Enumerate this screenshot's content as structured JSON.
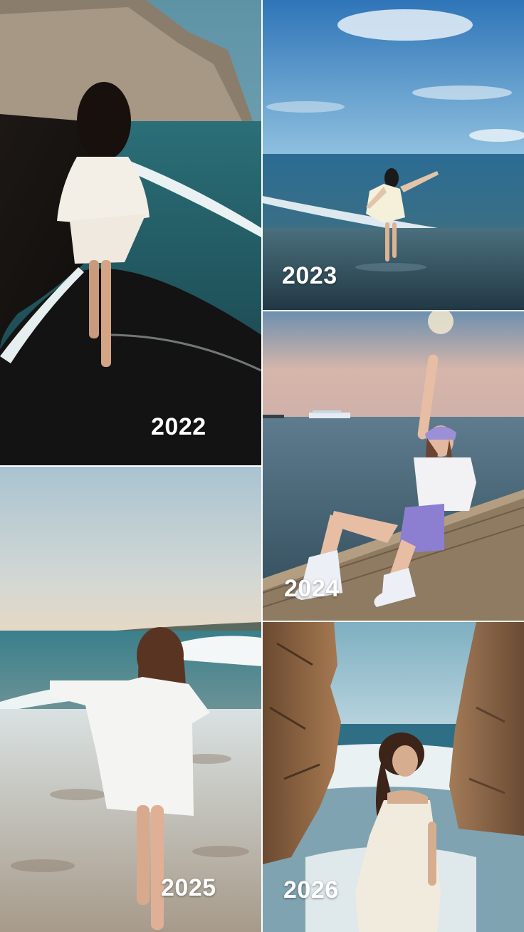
{
  "collage": {
    "panels": [
      {
        "id": "beach-black-sand",
        "year": "2022"
      },
      {
        "id": "beach-blue-sky",
        "year": "2023"
      },
      {
        "id": "pier-sunset",
        "year": "2024"
      },
      {
        "id": "beach-waves",
        "year": "2025"
      },
      {
        "id": "rocky-cove",
        "year": "2026"
      }
    ]
  }
}
